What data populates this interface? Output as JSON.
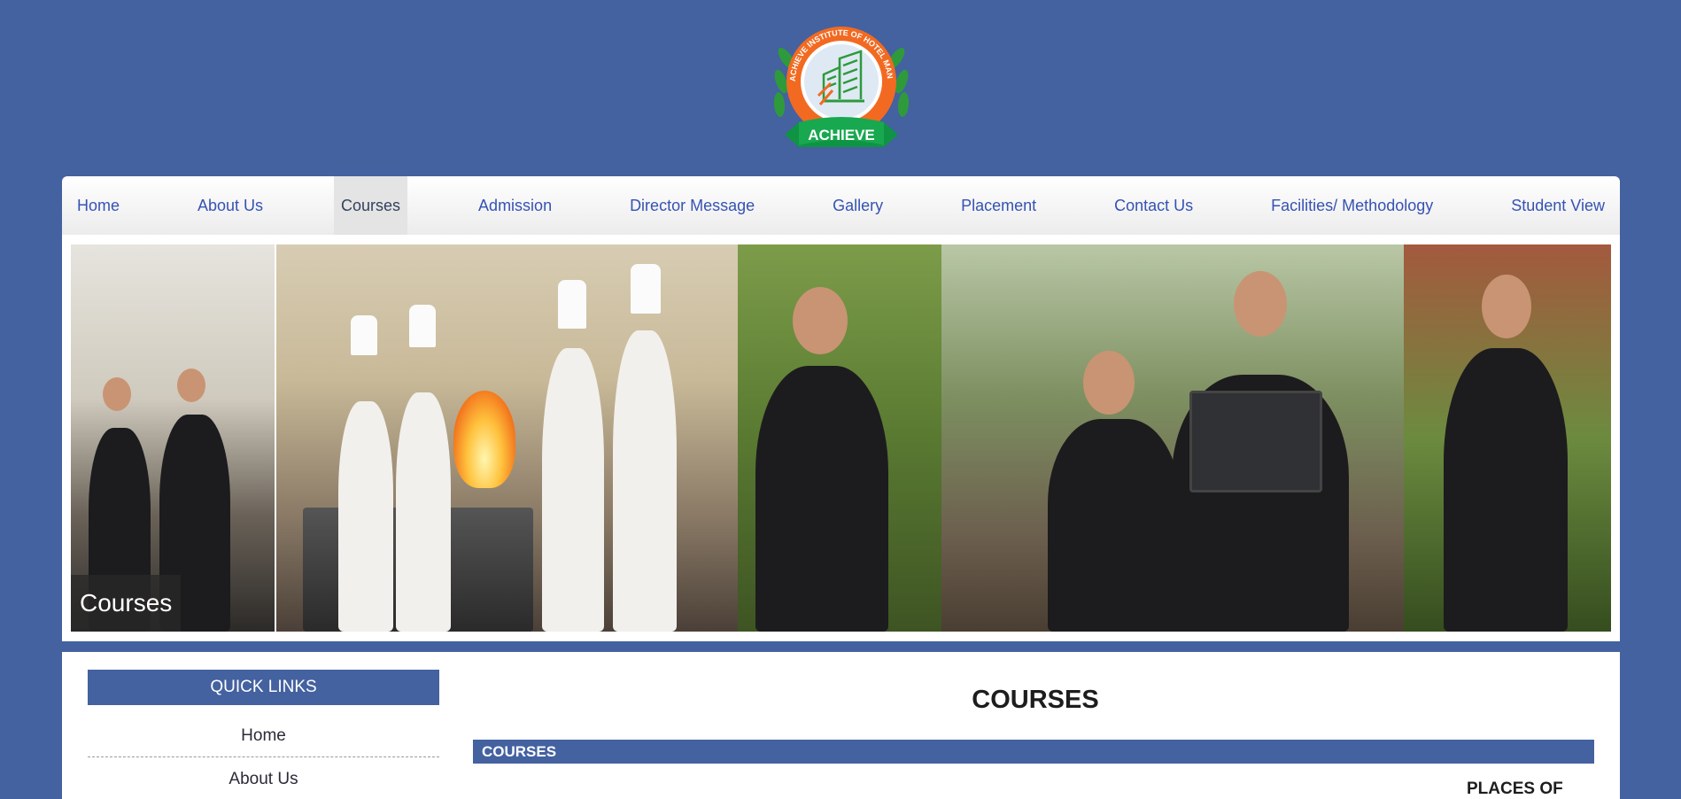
{
  "logo": {
    "ring_text": "ACHIEVE INSTITUTE OF HOTEL MANAGEMENT",
    "ribbon_text": "ACHIEVE"
  },
  "nav": {
    "items": [
      {
        "label": "Home"
      },
      {
        "label": "About Us"
      },
      {
        "label": "Courses"
      },
      {
        "label": "Admission"
      },
      {
        "label": "Director Message"
      },
      {
        "label": "Gallery"
      },
      {
        "label": "Placement"
      },
      {
        "label": "Contact Us"
      },
      {
        "label": "Facilities/ Methodology"
      },
      {
        "label": "Student View"
      }
    ],
    "active": "Courses"
  },
  "banner": {
    "caption": "Courses"
  },
  "quick_links": {
    "title": "QUICK LINKS",
    "items": [
      {
        "label": "Home"
      },
      {
        "label": "About Us"
      }
    ]
  },
  "main": {
    "title": "COURSES",
    "section_bar": "COURSES",
    "side_heading": "PLACES OF"
  },
  "colors": {
    "background": "#4461a0",
    "nav_link": "#3652b4",
    "section_bar": "#4461a0"
  }
}
